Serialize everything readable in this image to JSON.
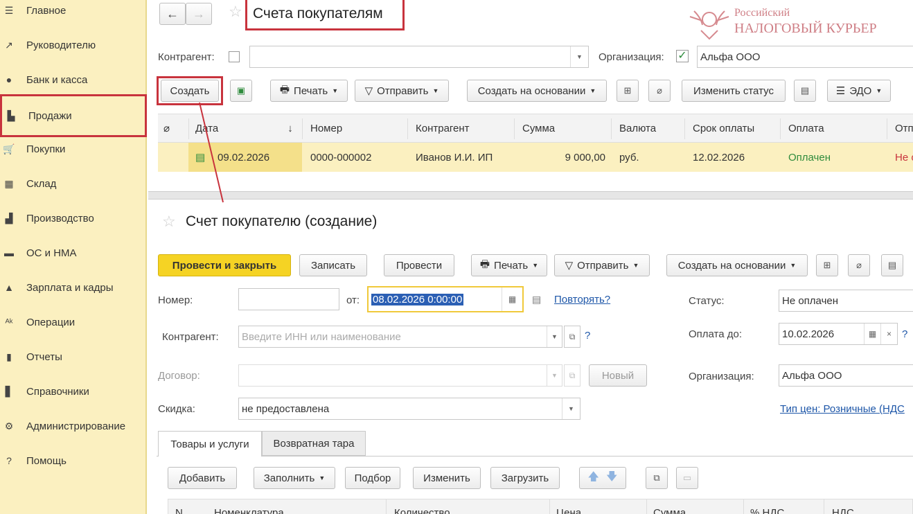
{
  "sidebar": {
    "items": [
      {
        "icon": "menu-icon",
        "glyph": "☰",
        "label": "Главное"
      },
      {
        "icon": "trend-icon",
        "glyph": "↗",
        "label": "Руководителю"
      },
      {
        "icon": "bank-icon",
        "glyph": "●",
        "label": "Банк и касса"
      },
      {
        "icon": "bag-icon",
        "glyph": "▙",
        "label": "Продажи",
        "active": true
      },
      {
        "icon": "cart-icon",
        "glyph": "🛒",
        "label": "Покупки"
      },
      {
        "icon": "warehouse-icon",
        "glyph": "▦",
        "label": "Склад"
      },
      {
        "icon": "factory-icon",
        "glyph": "▟",
        "label": "Производство"
      },
      {
        "icon": "truck-icon",
        "glyph": "▬",
        "label": "ОС и НМА"
      },
      {
        "icon": "person-icon",
        "glyph": "▲",
        "label": "Зарплата и кадры"
      },
      {
        "icon": "operations-icon",
        "glyph": "ᴬᵏ",
        "label": "Операции"
      },
      {
        "icon": "chart-icon",
        "glyph": "▮",
        "label": "Отчеты"
      },
      {
        "icon": "book-icon",
        "glyph": "▋",
        "label": "Справочники"
      },
      {
        "icon": "gear-icon",
        "glyph": "⚙",
        "label": "Администрирование"
      },
      {
        "icon": "help-icon",
        "glyph": "?",
        "label": "Помощь"
      }
    ]
  },
  "list": {
    "title": "Счета покупателям",
    "contragent_label": "Контрагент:",
    "org_label": "Организация:",
    "org_value": "Альфа ООО",
    "toolbar": {
      "create": "Создать",
      "print": "Печать",
      "send": "Отправить",
      "create_based": "Создать на основании",
      "change_status": "Изменить статус",
      "edo": "ЭДО"
    },
    "columns": [
      "Дата",
      "Номер",
      "Контрагент",
      "Сумма",
      "Валюта",
      "Срок оплаты",
      "Оплата",
      "Отп"
    ],
    "rows": [
      {
        "date": "09.02.2026",
        "number": "0000-000002",
        "contragent": "Иванов И.И. ИП",
        "sum": "9 000,00",
        "currency": "руб.",
        "due": "12.02.2026",
        "payment": "Оплачен",
        "shipment": "Не о"
      }
    ]
  },
  "form": {
    "title": "Счет покупателю (создание)",
    "toolbar": {
      "post_close": "Провести и закрыть",
      "save": "Записать",
      "post": "Провести",
      "print": "Печать",
      "send": "Отправить",
      "create_based": "Создать на основании"
    },
    "number_label": "Номер:",
    "from_label": "от:",
    "date_value": "08.02.2026  0:00:00",
    "repeat_link": "Повторять?",
    "status_label": "Статус:",
    "status_value": "Не оплачен",
    "contragent_label": "Контрагент:",
    "contragent_placeholder": "Введите ИНН или наименование",
    "pay_until_label": "Оплата до:",
    "pay_until_value": "10.02.2026",
    "contract_label": "Договор:",
    "new_button": "Новый",
    "org_label": "Организация:",
    "org_value": "Альфа ООО",
    "discount_label": "Скидка:",
    "discount_value": "не предоставлена",
    "price_type_link": "Тип цен: Розничные (НДС",
    "tabs": [
      "Товары и услуги",
      "Возвратная тара"
    ],
    "table_toolbar": {
      "add": "Добавить",
      "fill": "Заполнить",
      "pick": "Подбор",
      "change": "Изменить",
      "load": "Загрузить"
    },
    "table_columns": [
      "N",
      "Номенклатура",
      "Количество",
      "Цена",
      "Сумма",
      "% НДС",
      "НДС"
    ]
  },
  "watermark": {
    "line1": "Российский",
    "line2": "НАЛОГОВЫЙ КУРЬЕР"
  },
  "colors": {
    "sidebar_bg": "#fbf0c0",
    "highlight_red": "#c8333d",
    "primary_button": "#f5d324",
    "paid_green": "#2e8b3c",
    "link_blue": "#1d56a8"
  }
}
